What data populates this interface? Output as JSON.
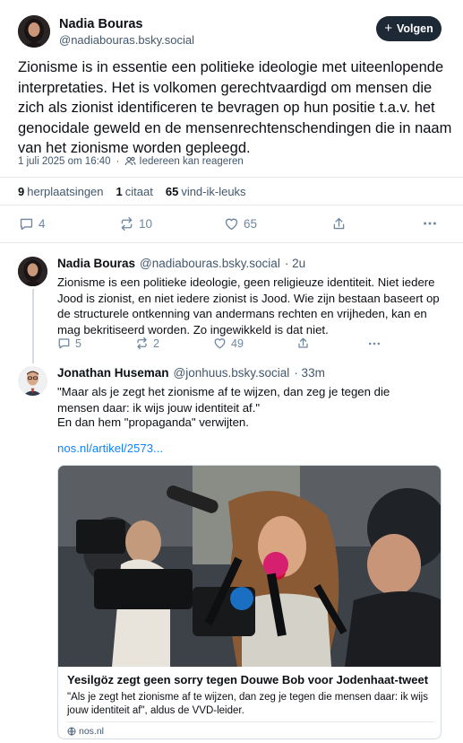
{
  "main_post": {
    "author_name": "Nadia Bouras",
    "author_handle": "@nadiabouras.bsky.social",
    "follow_label": "Volgen",
    "text": "Zionisme is in essentie een politieke ideologie met uiteenlopende interpretaties. Het is volkomen gerechtvaardigd om mensen die zich als zionist identificeren te bevragen op hun positie t.a.v. het genocidale geweld en de mensenrechtenschendingen die in naam van het zionisme worden gepleegd.",
    "timestamp": "1 juli 2025 om 16:40",
    "reply_setting": "Iedereen kan reageren",
    "stats": {
      "reposts_count": "9",
      "reposts_label": "herplaatsingen",
      "quotes_count": "1",
      "quotes_label": "citaat",
      "likes_count": "65",
      "likes_label": "vind-ik-leuks"
    },
    "actions": {
      "replies": "4",
      "reposts": "10",
      "likes": "65"
    }
  },
  "reply_1": {
    "author_name": "Nadia Bouras",
    "author_handle": "@nadiabouras.bsky.social",
    "age": "· 2u",
    "text": "Zionisme is een politieke ideologie, geen religieuze identiteit. Niet iedere Jood is zionist, en niet iedere zionist is Jood. Wie zijn bestaan baseert op de structurele ontkenning van andermans rechten en vrijheden, kan en mag bekritiseerd worden. Zo ingewikkeld is dat niet.",
    "actions": {
      "replies": "5",
      "reposts": "2",
      "likes": "49"
    }
  },
  "reply_2": {
    "author_name": "Jonathan Huseman",
    "author_handle": "@jonhuus.bsky.social",
    "age": "· 33m",
    "text_line1": "\"Maar als je zegt het zionisme af te wijzen, dan zeg je tegen die mensen daar: ik wijs jouw identiteit af.\"",
    "text_line2": "En dan hem \"propaganda\" verwijten.",
    "link": "nos.nl/artikel/2573...",
    "card": {
      "title": "Yesilgöz zegt geen sorry tegen Douwe Bob voor Jodenhaat-tweet",
      "description": "\"Als je zegt het zionisme af te wijzen, dan zeg je tegen die mensen daar: ik wijs jouw identiteit af\", aldus de VVD-leider.",
      "source": "nos.nl"
    }
  },
  "colors": {
    "text": "#0b0f14",
    "muted": "#42576c",
    "icon": "#6f869f",
    "link": "#1083fe",
    "follow_bg": "#1e2936",
    "border": "#e4e8ec"
  }
}
